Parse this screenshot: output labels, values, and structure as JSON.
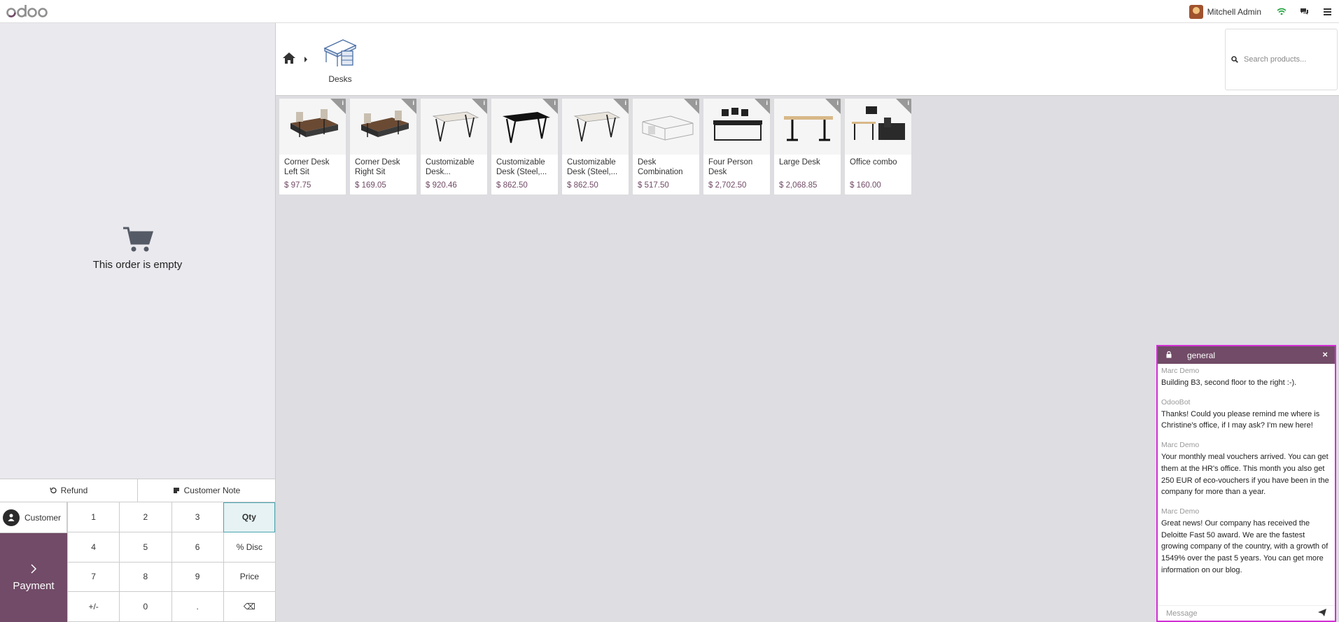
{
  "navbar": {
    "user_name": "Mitchell Admin"
  },
  "category": {
    "label": "Desks"
  },
  "search": {
    "placeholder": "Search products..."
  },
  "order": {
    "empty_text": "This order is empty"
  },
  "actions": {
    "refund": "Refund",
    "customer_note": "Customer Note"
  },
  "pad": {
    "customer": "Customer",
    "payment": "Payment",
    "keys": [
      "1",
      "2",
      "3",
      "Qty",
      "4",
      "5",
      "6",
      "% Disc",
      "7",
      "8",
      "9",
      "Price",
      "+/-",
      "0",
      ".",
      "⌫"
    ]
  },
  "products": [
    {
      "name": "Corner Desk Left Sit",
      "price": "$ 97.75"
    },
    {
      "name": "Corner Desk Right Sit",
      "price": "$ 169.05"
    },
    {
      "name": "Customizable Desk...",
      "price": "$ 920.46"
    },
    {
      "name": "Customizable Desk (Steel,...",
      "price": "$ 862.50"
    },
    {
      "name": "Customizable Desk (Steel,...",
      "price": "$ 862.50"
    },
    {
      "name": "Desk Combination",
      "price": "$ 517.50"
    },
    {
      "name": "Four Person Desk",
      "price": "$ 2,702.50"
    },
    {
      "name": "Large Desk",
      "price": "$ 2,068.85"
    },
    {
      "name": "Office combo",
      "price": "$ 160.00"
    }
  ],
  "chat": {
    "title": "general",
    "composer_placeholder": "Message",
    "messages": [
      {
        "author": "Marc Demo",
        "body": "Building B3, second floor to the right :-)."
      },
      {
        "author": "OdooBot",
        "body": "Thanks! Could you please remind me where is Christine's office, if I may ask? I'm new here!"
      },
      {
        "author": "Marc Demo",
        "body": "Your monthly meal vouchers arrived. You can get them at the HR's office. This month you also get 250 EUR of eco-vouchers if you have been in the company for more than a year."
      },
      {
        "author": "Marc Demo",
        "body": "Great news! Our company has received the Deloitte Fast 50 award. We are the fastest growing company of the country, with a growth of 1549% over the past 5 years. You can get more information on our blog."
      }
    ]
  },
  "colors": {
    "brand": "#714b67",
    "chat_border": "#d12fd3",
    "wifi": "#28a745"
  }
}
